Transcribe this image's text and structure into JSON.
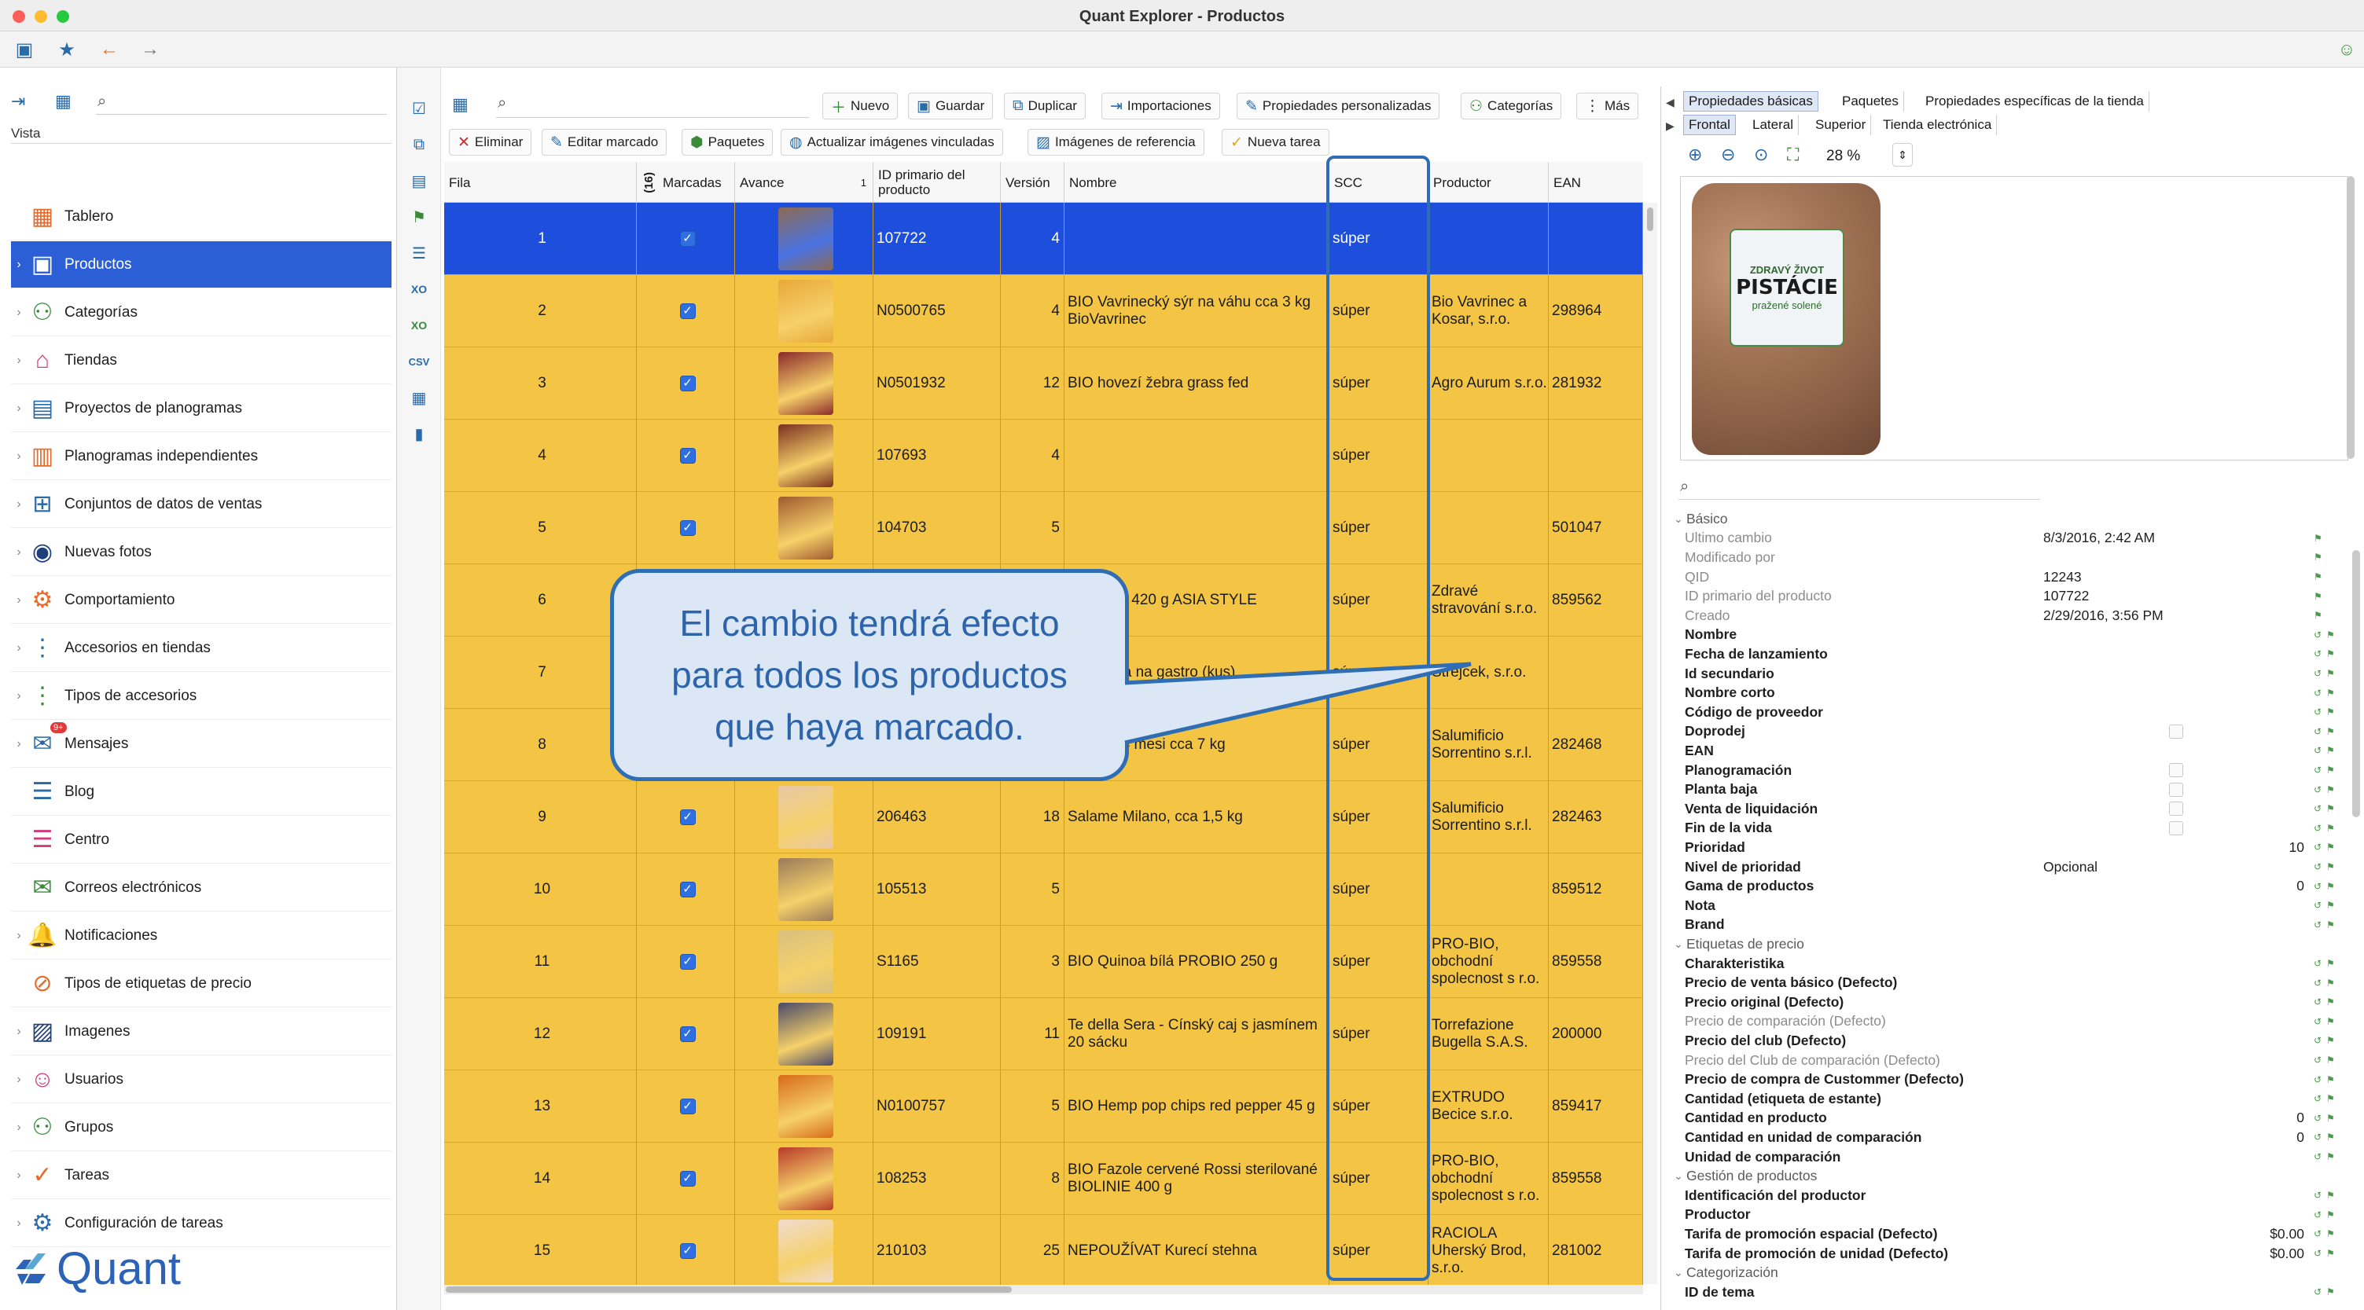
{
  "window": {
    "title": "Quant Explorer - Productos"
  },
  "sidebar": {
    "view_label": "Vista",
    "items": [
      {
        "label": "Tablero",
        "icon": "dashboard-icon",
        "color": "#e86a2a",
        "glyph": "▦"
      },
      {
        "label": "Productos",
        "icon": "products-icon",
        "color": "#ffffff",
        "glyph": "▣"
      },
      {
        "label": "Categorías",
        "icon": "categories-icon",
        "color": "#3a8a3a",
        "glyph": "⚇"
      },
      {
        "label": "Tiendas",
        "icon": "stores-icon",
        "color": "#d23a7a",
        "glyph": "⌂"
      },
      {
        "label": "Proyectos de planogramas",
        "icon": "planogram-projects-icon",
        "color": "#2a6aa8",
        "glyph": "▤"
      },
      {
        "label": "Planogramas independientes",
        "icon": "independent-planograms-icon",
        "color": "#e86a2a",
        "glyph": "▥"
      },
      {
        "label": "Conjuntos de datos de ventas",
        "icon": "sales-datasets-icon",
        "color": "#2a6aa8",
        "glyph": "⊞"
      },
      {
        "label": "Nuevas fotos",
        "icon": "camera-icon",
        "color": "#1e3f7a",
        "glyph": "◉"
      },
      {
        "label": "Comportamiento",
        "icon": "behavior-icon",
        "color": "#e86a2a",
        "glyph": "⚙"
      },
      {
        "label": "Accesorios en tiendas",
        "icon": "store-accessories-icon",
        "color": "#2a6aa8",
        "glyph": "⋮"
      },
      {
        "label": "Tipos de accesorios",
        "icon": "accessory-types-icon",
        "color": "#3a8a3a",
        "glyph": "⋮"
      },
      {
        "label": "Mensajes",
        "icon": "messages-icon",
        "color": "#2a6aa8",
        "glyph": "✉"
      },
      {
        "label": "Blog",
        "icon": "blog-icon",
        "color": "#2a6aa8",
        "glyph": "☰"
      },
      {
        "label": "Centro",
        "icon": "center-icon",
        "color": "#d23a7a",
        "glyph": "☰"
      },
      {
        "label": "Correos electrónicos",
        "icon": "email-icon",
        "color": "#3a8a3a",
        "glyph": "✉"
      },
      {
        "label": "Notificaciones",
        "icon": "notifications-icon",
        "color": "#2a6aa8",
        "glyph": "🔔"
      },
      {
        "label": "Tipos de etiquetas de precio",
        "icon": "price-tag-types-icon",
        "color": "#e86a2a",
        "glyph": "⊘"
      },
      {
        "label": "Imagenes",
        "icon": "images-icon",
        "color": "#1e3f7a",
        "glyph": "▨"
      },
      {
        "label": "Usuarios",
        "icon": "users-icon",
        "color": "#d23a7a",
        "glyph": "☺"
      },
      {
        "label": "Grupos",
        "icon": "groups-icon",
        "color": "#3a8a3a",
        "glyph": "⚇"
      },
      {
        "label": "Tareas",
        "icon": "tasks-icon",
        "color": "#e86a2a",
        "glyph": "✓"
      },
      {
        "label": "Configuración de tareas",
        "icon": "task-settings-icon",
        "color": "#2a6aa8",
        "glyph": "⚙"
      }
    ],
    "messages_badge": "9+",
    "logo_text": "Quant"
  },
  "toolbar1": {
    "nuevo": "Nuevo",
    "guardar": "Guardar",
    "duplicar": "Duplicar",
    "importaciones": "Importaciones",
    "propiedades": "Propiedades personalizadas",
    "categorias": "Categorías",
    "mas": "Más"
  },
  "toolbar2": {
    "eliminar": "Eliminar",
    "editar": "Editar marcado",
    "paquetes": "Paquetes",
    "actualizar": "Actualizar imágenes vinculadas",
    "imagenes_ref": "Imágenes de referencia",
    "nueva_tarea": "Nueva tarea"
  },
  "table": {
    "headers": {
      "fila": "Fila",
      "count": "(16)",
      "marcadas": "Marcadas",
      "avance": "Avance",
      "sort": "1",
      "id": "ID primario del producto",
      "version": "Versión",
      "nombre": "Nombre",
      "scc": "SCC",
      "productor": "Productor",
      "ean": "EAN"
    },
    "rows": [
      {
        "fila": "1",
        "id": "107722",
        "version": "4",
        "nombre": "",
        "scc": "súper",
        "productor": "",
        "ean": "",
        "thumb": "#8c6a50"
      },
      {
        "fila": "2",
        "id": "N0500765",
        "version": "4",
        "nombre": "BIO Vavrinecký sýr na váhu cca 3 kg BioVavrinec",
        "scc": "súper",
        "productor": "Bio Vavrinec a Kosar, s.r.o.",
        "ean": "298964",
        "thumb": "#e8a83a"
      },
      {
        "fila": "3",
        "id": "N0501932",
        "version": "12",
        "nombre": "BIO hovezí žebra grass fed",
        "scc": "súper",
        "productor": "Agro Aurum s.r.o.",
        "ean": "281932",
        "thumb": "#8b2a2a"
      },
      {
        "fila": "4",
        "id": "107693",
        "version": "4",
        "nombre": "",
        "scc": "súper",
        "productor": "",
        "ean": "",
        "thumb": "#7a3020"
      },
      {
        "fila": "5",
        "id": "104703",
        "version": "5",
        "nombre": "",
        "scc": "súper",
        "productor": "",
        "ean": "501047",
        "thumb": "#a05a30"
      },
      {
        "fila": "6",
        "id": "",
        "version": "",
        "nombre": "ow Curry 420 g ASIA STYLE",
        "scc": "súper",
        "productor": "Zdravé stravování s.r.o.",
        "ean": "859562",
        "thumb": ""
      },
      {
        "fila": "7",
        "id": "",
        "version": "",
        "nombre": "a klobása na gastro (kus)",
        "scc": "súper",
        "productor": "Strejcek, s.r.o.",
        "ean": "",
        "thumb": ""
      },
      {
        "fila": "8",
        "id": "",
        "version": "",
        "nombre": "Sasso 14 mesi cca 7 kg",
        "scc": "súper",
        "productor": "Salumificio Sorrentino s.r.l.",
        "ean": "282468",
        "thumb": ""
      },
      {
        "fila": "9",
        "id": "206463",
        "version": "18",
        "nombre": "Salame Milano, cca 1,5 kg",
        "scc": "súper",
        "productor": "Salumificio Sorrentino s.r.l.",
        "ean": "282463",
        "thumb": "#e8c8a8"
      },
      {
        "fila": "10",
        "id": "105513",
        "version": "5",
        "nombre": "",
        "scc": "súper",
        "productor": "",
        "ean": "859512",
        "thumb": "#9a7a5a"
      },
      {
        "fila": "11",
        "id": "S1165",
        "version": "3",
        "nombre": "BIO Quinoa bílá PROBIO 250 g",
        "scc": "súper",
        "productor": "PRO-BIO, obchodní spolecnost s r.o.",
        "ean": "859558",
        "thumb": "#d8c080"
      },
      {
        "fila": "12",
        "id": "109191",
        "version": "11",
        "nombre": "Te della Sera - Cínský caj s jasmínem 20 sácku",
        "scc": "súper",
        "productor": "Torrefazione Bugella S.A.S.",
        "ean": "200000",
        "thumb": "#4a4a6a"
      },
      {
        "fila": "13",
        "id": "N0100757",
        "version": "5",
        "nombre": "BIO Hemp pop chips red pepper 45 g",
        "scc": "súper",
        "productor": "EXTRUDO Becice s.r.o.",
        "ean": "859417",
        "thumb": "#d86a1a"
      },
      {
        "fila": "14",
        "id": "108253",
        "version": "8",
        "nombre": "BIO Fazole cervené Rossi sterilované BIOLINIE 400 g",
        "scc": "súper",
        "productor": "PRO-BIO, obchodní spolecnost s r.o.",
        "ean": "859558",
        "thumb": "#b83a2a"
      },
      {
        "fila": "15",
        "id": "210103",
        "version": "25",
        "nombre": "NEPOUŽÍVAT Kurecí stehna",
        "scc": "súper",
        "productor": "RACIOLA Uherský Brod, s.r.o.",
        "ean": "281002",
        "thumb": "#f0dcd0"
      }
    ]
  },
  "callout": {
    "text": "El cambio tendrá efecto para todos los productos que haya marcado."
  },
  "right_panel": {
    "tabs_top": [
      "Propiedades básicas",
      "Paquetes",
      "Propiedades específicas de la tienda"
    ],
    "tabs_view": [
      "Frontal",
      "Lateral",
      "Superior",
      "Tienda electrónica"
    ],
    "zoom": "28 %",
    "package": {
      "brand": "ZDRAVÝ ŽIVOT",
      "name": "PISTÁCIE",
      "sub": "pražené solené"
    },
    "props": [
      {
        "name": "Básico",
        "kind": "section"
      },
      {
        "name": "Ultimo cambio",
        "kind": "dim",
        "value": "8/3/2016, 2:42 AM"
      },
      {
        "name": "Modificado por",
        "kind": "dim",
        "value": ""
      },
      {
        "name": "QID",
        "kind": "dim",
        "value": "12243"
      },
      {
        "name": "ID primario del producto",
        "kind": "dim",
        "value": "107722"
      },
      {
        "name": "Creado",
        "kind": "dim",
        "value": "2/29/2016, 3:56 PM"
      },
      {
        "name": "Nombre",
        "kind": "bold",
        "value": ""
      },
      {
        "name": "Fecha de lanzamiento",
        "kind": "bold",
        "value": ""
      },
      {
        "name": "Id secundario",
        "kind": "bold",
        "value": ""
      },
      {
        "name": "Nombre corto",
        "kind": "bold",
        "value": ""
      },
      {
        "name": "Código de proveedor",
        "kind": "bold",
        "value": ""
      },
      {
        "name": "Doprodej",
        "kind": "bold",
        "check": true
      },
      {
        "name": "EAN",
        "kind": "bold",
        "value": ""
      },
      {
        "name": "Planogramación",
        "kind": "bold",
        "check": true
      },
      {
        "name": "Planta baja",
        "kind": "bold",
        "check": true
      },
      {
        "name": "Venta de liquidación",
        "kind": "bold",
        "check": true
      },
      {
        "name": "Fin de la vida",
        "kind": "bold",
        "check": true
      },
      {
        "name": "Prioridad",
        "kind": "bold",
        "rvalue": "10"
      },
      {
        "name": "Nivel de prioridad",
        "kind": "bold",
        "value": "Opcional"
      },
      {
        "name": "Gama de productos",
        "kind": "bold",
        "rvalue": "0"
      },
      {
        "name": "Nota",
        "kind": "bold",
        "value": ""
      },
      {
        "name": "Brand",
        "kind": "bold",
        "value": ""
      },
      {
        "name": "Etiquetas de precio",
        "kind": "section"
      },
      {
        "name": "Charakteristika",
        "kind": "bold",
        "value": ""
      },
      {
        "name": "Precio de venta básico (Defecto)",
        "kind": "bold",
        "value": ""
      },
      {
        "name": "Precio original (Defecto)",
        "kind": "bold",
        "value": ""
      },
      {
        "name": "Precio de comparación (Defecto)",
        "kind": "dim",
        "value": ""
      },
      {
        "name": "Precio del club (Defecto)",
        "kind": "bold",
        "value": ""
      },
      {
        "name": "Precio del Club de comparación (Defecto)",
        "kind": "dim",
        "value": ""
      },
      {
        "name": "Precio de compra de Custommer (Defecto)",
        "kind": "bold",
        "value": ""
      },
      {
        "name": "Cantidad (etiqueta de estante)",
        "kind": "bold",
        "value": ""
      },
      {
        "name": "Cantidad en producto",
        "kind": "bold",
        "rvalue": "0"
      },
      {
        "name": "Cantidad en unidad de comparación",
        "kind": "bold",
        "rvalue": "0"
      },
      {
        "name": "Unidad de comparación",
        "kind": "bold",
        "value": ""
      },
      {
        "name": "Gestión de productos",
        "kind": "section"
      },
      {
        "name": "Identificación del productor",
        "kind": "bold",
        "value": ""
      },
      {
        "name": "Productor",
        "kind": "bold",
        "value": ""
      },
      {
        "name": "Tarifa de promoción espacial (Defecto)",
        "kind": "bold",
        "rvalue": "$0.00"
      },
      {
        "name": "Tarifa de promoción de unidad (Defecto)",
        "kind": "bold",
        "rvalue": "$0.00"
      },
      {
        "name": "Categorización",
        "kind": "section"
      },
      {
        "name": "ID de tema",
        "kind": "bold",
        "value": ""
      }
    ]
  },
  "colors": {
    "accent": "#2c5fd6",
    "row_marked": "#f4c544",
    "row_selected": "#1d4fdc",
    "callout_border": "#2f6db4"
  }
}
